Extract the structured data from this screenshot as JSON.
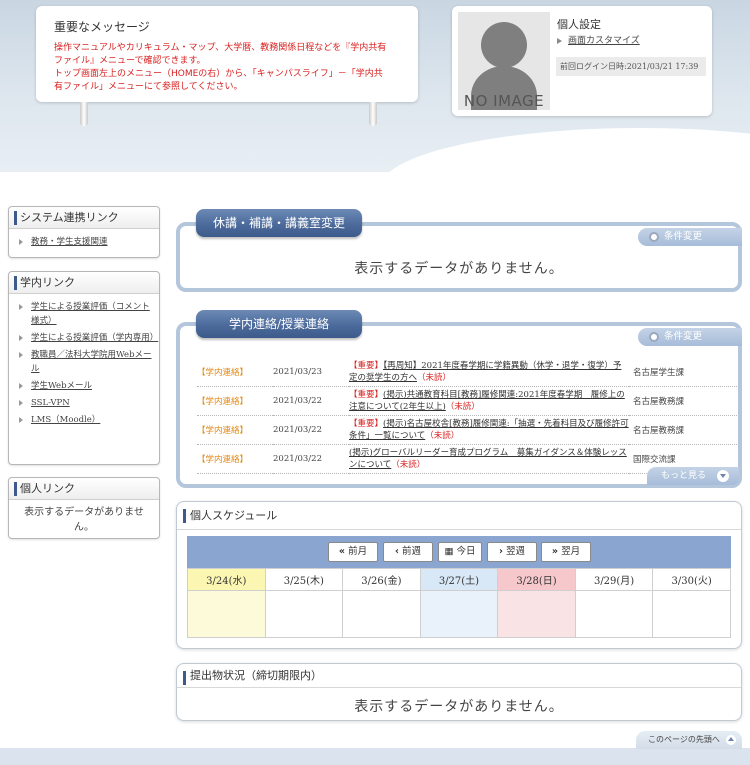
{
  "message": {
    "title": "重要なメッセージ",
    "line1": "操作マニュアルやカリキュラム・マップ、大学暦、教務関係日程などを『学内共有",
    "line2": "ファイル』メニューで確認できます。",
    "line3": "トップ画面左上のメニュー（HOMEの右）から、「キャンパスライフ」－「学内共",
    "line4": "有ファイル」メニューにて参照してください。"
  },
  "profile": {
    "no_image": "NO IMAGE",
    "title": "個人設定",
    "customize_link": "画面カスタマイズ",
    "last_login": "前回ログイン日時:2021/03/21 17:39"
  },
  "sidebar": {
    "system_links": {
      "title": "システム連携リンク",
      "items": [
        "教務・学生支援関連"
      ]
    },
    "campus_links": {
      "title": "学内リンク",
      "items": [
        "学生による授業評価（コメント様式）",
        "学生による授業評価（学内専用）",
        "教職員／法科大学院用Webメール",
        "学生Webメール",
        "SSL-VPN",
        "LMS（Moodle）"
      ]
    },
    "personal_links": {
      "title": "個人リンク",
      "empty": "表示するデータがありません。"
    }
  },
  "cancellations": {
    "tab": "休講・補講・講義室変更",
    "condition": "条件変更",
    "empty": "表示するデータがありません。"
  },
  "notices": {
    "tab": "学内連絡/授業連絡",
    "condition": "条件変更",
    "more": "もっと見る",
    "rows": [
      {
        "category": "【学内連絡】",
        "date": "2021/03/23",
        "badge": "【重要】",
        "title": "【再周知】2021年度春学期に学籍異動（休学・退学・復学）予定の奨学生の方へ",
        "unread": "（未読）",
        "source": "名古屋学生課"
      },
      {
        "category": "【学内連絡】",
        "date": "2021/03/22",
        "badge": "【重要】",
        "title": "(掲示)共通教育科目[教務]履修関連:2021年度春学期　履修上の注意について(2年生以上)",
        "unread": "（未読）",
        "source": "名古屋教務課"
      },
      {
        "category": "【学内連絡】",
        "date": "2021/03/22",
        "badge": "【重要】",
        "title": "(掲示)名古屋校舎[教務]履修関連:「抽選・先着科目及び履修許可条件」一覧について",
        "unread": "（未読）",
        "source": "名古屋教務課"
      },
      {
        "category": "【学内連絡】",
        "date": "2021/03/22",
        "badge": "",
        "title": "(掲示)グローバルリーダー育成プログラム　募集ガイダンス＆体験レッスンについて",
        "unread": "（未読）",
        "source": "国際交流課"
      }
    ]
  },
  "schedule": {
    "title": "個人スケジュール",
    "nav": {
      "prev_month": "前月",
      "prev_week": "前週",
      "today": "今日",
      "next_week": "翌週",
      "next_month": "翌月"
    },
    "days": [
      "3/24(水)",
      "3/25(木)",
      "3/26(金)",
      "3/27(土)",
      "3/28(日)",
      "3/29(月)",
      "3/30(火)"
    ],
    "colors": {
      "today": "#fbf6b2",
      "saturday": "#d9e8f7",
      "sunday": "#f6c8cc",
      "nav_bar": "#8aa6d0"
    }
  },
  "submissions": {
    "title": "提出物状況（締切期限内）",
    "empty": "表示するデータがありません。"
  },
  "footer": {
    "to_top": "このページの先頭へ"
  },
  "colors": {
    "accent": "#3c5a8c",
    "tab_blue": "#4c6b9c",
    "alert_red": "#d81f1f",
    "category_orange": "#e08a1a"
  }
}
